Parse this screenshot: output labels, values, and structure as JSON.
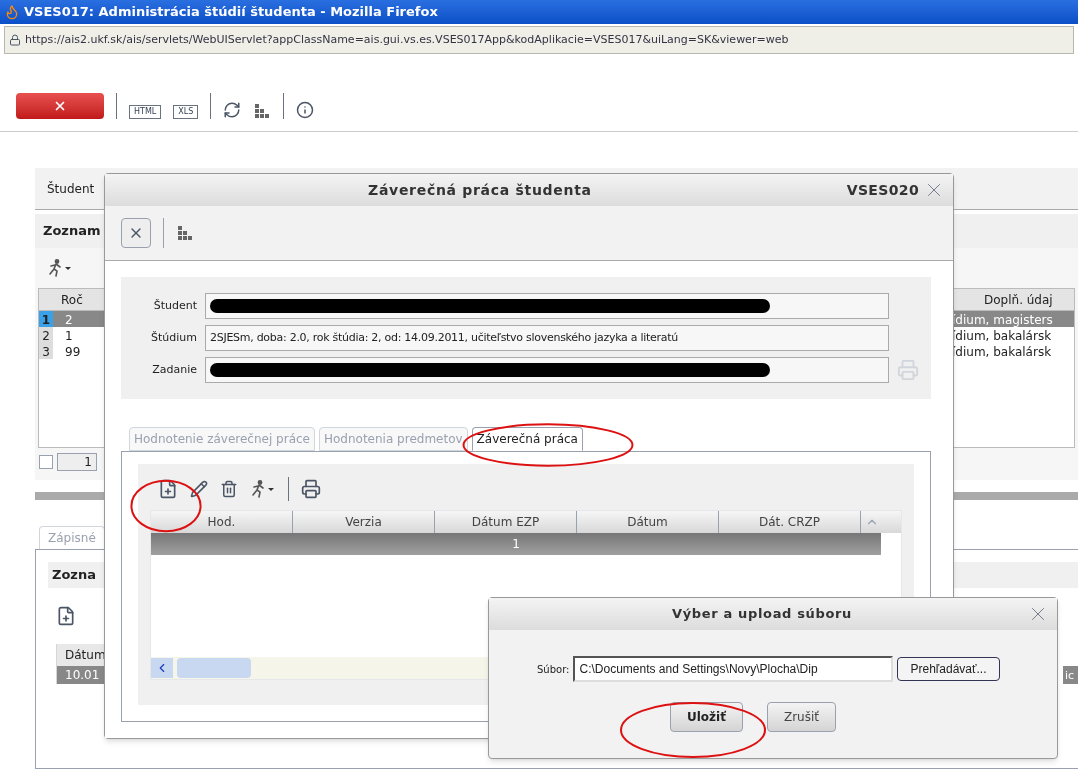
{
  "browser": {
    "title": "VSES017: Administrácia štúdií študenta - Mozilla Firefox",
    "url": "https://ais2.ukf.sk/ais/servlets/WebUIServlet?appClassName=ais.gui.vs.es.VSES017App&kodAplikacie=VSES017&uiLang=SK&viewer=web"
  },
  "toolbar": {
    "export_buttons": [
      "HTML",
      "XLS"
    ]
  },
  "main": {
    "student_label": "Študent",
    "list_title": "Zoznam",
    "table": {
      "columns": [
        "Roč",
        "Doplň. údaj"
      ],
      "rows": [
        {
          "index": "1",
          "year": "2",
          "extra": "ídium, magisters",
          "selected": true
        },
        {
          "index": "2",
          "year": "1",
          "extra": "ídium, bakalársk",
          "selected": false
        },
        {
          "index": "3",
          "year": "99",
          "extra": "ídium, bakalársk",
          "selected": false
        }
      ]
    },
    "pager": {
      "page": "1"
    },
    "lower_tab": "Zápisné",
    "lower_title": "Zozna",
    "lower_table": {
      "column": "Dátum",
      "rows": [
        {
          "date": "10.01",
          "extra": "ic",
          "selected": true
        }
      ]
    }
  },
  "thesis_dialog": {
    "title": "Záverečná práca študenta",
    "code": "VSES020",
    "fields": [
      {
        "label": "Študent",
        "redacted": true
      },
      {
        "label": "Štúdium",
        "value": "2SJESm, doba: 2.0, rok štúdia: 2, od: 14.09.2011, učiteľstvo slovenského jazyka a literatú",
        "redacted": false
      },
      {
        "label": "Zadanie",
        "redacted": true
      }
    ],
    "tabs": [
      {
        "label": "Hodnotenie záverečnej práce",
        "selected": false
      },
      {
        "label": "Hodnotenia predmetov",
        "selected": false
      },
      {
        "label": "Záverečná práca",
        "selected": true
      }
    ],
    "table": {
      "columns": [
        "Hod.",
        "Verzia",
        "Dátum EZP",
        "Dátum",
        "Dát. CRZP"
      ],
      "group_row": "1"
    }
  },
  "upload_dialog": {
    "title": "Výber a upload súboru",
    "file_label": "Súbor:",
    "file_value": "C:\\Documents and Settings\\Novy\\Plocha\\Dip",
    "browse_button": "Prehľadávať...",
    "buttons": [
      {
        "label": "Uložiť",
        "primary": true
      },
      {
        "label": "Zrušiť",
        "primary": false
      }
    ]
  }
}
